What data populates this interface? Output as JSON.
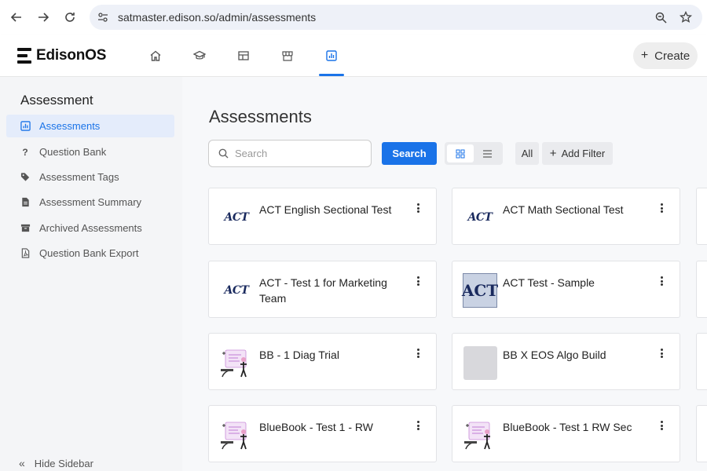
{
  "browser": {
    "url": "satmaster.edison.so/admin/assessments"
  },
  "app": {
    "brand": "EdisonOS",
    "create_label": "Create",
    "topnav": [
      {
        "icon": "home-icon"
      },
      {
        "icon": "graduation-cap-icon"
      },
      {
        "icon": "dashboard-icon"
      },
      {
        "icon": "store-icon"
      },
      {
        "icon": "assessment-chart-icon",
        "active": true
      }
    ]
  },
  "sidebar": {
    "title": "Assessment",
    "items": [
      {
        "label": "Assessments",
        "icon": "bar-chart-icon",
        "active": true
      },
      {
        "label": "Question Bank",
        "icon": "question-icon"
      },
      {
        "label": "Assessment Tags",
        "icon": "tags-icon"
      },
      {
        "label": "Assessment Summary",
        "icon": "summary-doc-icon"
      },
      {
        "label": "Archived Assessments",
        "icon": "archive-icon"
      },
      {
        "label": "Question Bank Export",
        "icon": "pdf-export-icon"
      }
    ],
    "hide_label": "Hide Sidebar"
  },
  "main": {
    "title": "Assessments",
    "search_placeholder": "Search",
    "search_button": "Search",
    "filter_all": "All",
    "add_filter": "Add Filter",
    "cards": [
      {
        "title": "ACT English Sectional Test",
        "thumb": "act-logo",
        "thumb_text": "ACT"
      },
      {
        "title": "ACT Math Sectional Test",
        "thumb": "act-logo",
        "thumb_text": "ACT"
      },
      {
        "title": "ACT - Test 1 for Marketing Team",
        "thumb": "act-logo",
        "thumb_text": "ACT"
      },
      {
        "title": "ACT Test - Sample",
        "thumb": "act-box",
        "thumb_text": "ACT"
      },
      {
        "title": "BB - 1 Diag Trial",
        "thumb": "illustration"
      },
      {
        "title": "BB X EOS Algo Build",
        "thumb": "blank"
      },
      {
        "title": "BlueBook - Test 1 - RW",
        "thumb": "illustration"
      },
      {
        "title": "BlueBook - Test 1 RW Sec",
        "thumb": "illustration"
      }
    ]
  },
  "colors": {
    "accent": "#1a73e8",
    "active_bg": "#e4ecfb"
  }
}
